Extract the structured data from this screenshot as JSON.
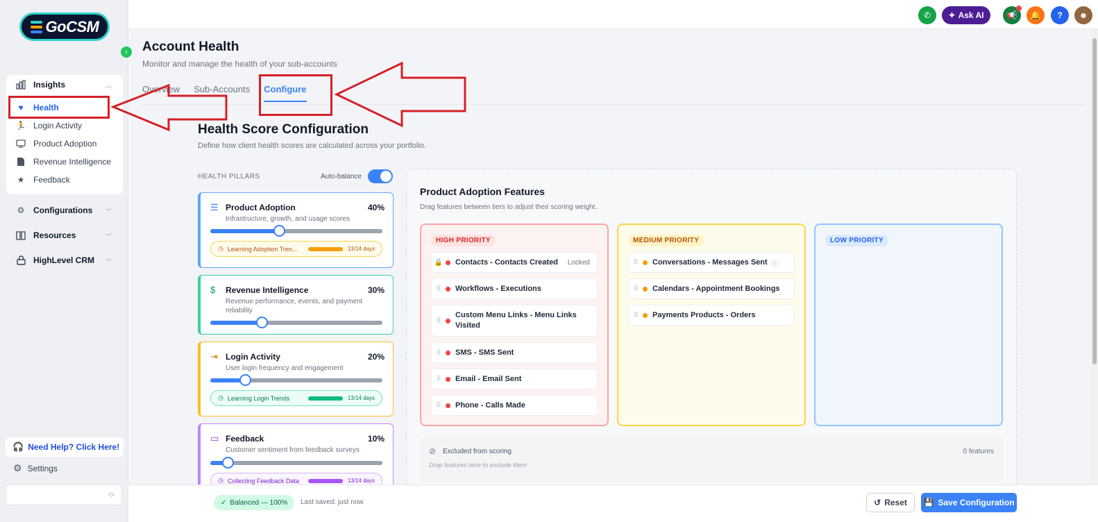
{
  "app": {
    "logo_text": "GoCSM"
  },
  "sidebar": {
    "insights": {
      "label": "Insights",
      "items": [
        {
          "label": "Health",
          "icon": "heart-pulse-icon",
          "active": true
        },
        {
          "label": "Login Activity",
          "icon": "running-icon"
        },
        {
          "label": "Product Adoption",
          "icon": "monitor-icon"
        },
        {
          "label": "Revenue Intelligence",
          "icon": "document-icon"
        },
        {
          "label": "Feedback",
          "icon": "star-icon"
        }
      ]
    },
    "groups": [
      {
        "label": "Configurations",
        "icon": "gear-icon"
      },
      {
        "label": "Resources",
        "icon": "book-icon"
      },
      {
        "label": "HighLevel CRM",
        "icon": "lock-icon"
      }
    ],
    "help_label": "Need Help? Click Here!",
    "settings_label": "Settings"
  },
  "topbar": {
    "ask_ai_label": "Ask AI"
  },
  "page": {
    "title": "Account Health",
    "subtitle": "Monitor and manage the health of your sub-accounts",
    "tabs": [
      "Overview",
      "Sub-Accounts",
      "Configure"
    ]
  },
  "config": {
    "title": "Health Score Configuration",
    "subtitle": "Define how client health scores are calculated across your portfolio.",
    "pillars_label": "HEALTH PILLARS",
    "auto_balance_label": "Auto-balance",
    "auto_balance_on": true,
    "pillars": [
      {
        "name": "Product Adoption",
        "pct": "40%",
        "value": 0.4,
        "desc": "Infrastructure, growth, and usage scores",
        "color": "#60a5fa",
        "trend": {
          "label": "Learning Adoption Tren...",
          "days": "13/14 days",
          "color": "#f59e0b"
        }
      },
      {
        "name": "Revenue Intelligence",
        "pct": "30%",
        "value": 0.3,
        "desc": "Revenue performance, events, and payment reliability",
        "color": "#34d399"
      },
      {
        "name": "Login Activity",
        "pct": "20%",
        "value": 0.2,
        "desc": "User login frequency and engagement",
        "color": "#fbbf24",
        "trend": {
          "label": "Learning Login Trends",
          "days": "13/14 days",
          "color": "#10b981"
        }
      },
      {
        "name": "Feedback",
        "pct": "10%",
        "value": 0.1,
        "desc": "Customer sentiment from feedback surveys",
        "color": "#c084fc",
        "trend": {
          "label": "Collecting Feedback Data",
          "days": "13/14 days",
          "color": "#a855f7"
        }
      }
    ]
  },
  "features": {
    "title": "Product Adoption Features",
    "subtitle": "Drag features between tiers to adjust their scoring weight.",
    "tiers": {
      "high": {
        "label": "HIGH PRIORITY",
        "items": [
          {
            "name": "Contacts - Contacts Created",
            "locked_label": "Locked"
          },
          {
            "name": "Workflows - Executions"
          },
          {
            "name": "Custom Menu Links - Menu Links Visited"
          },
          {
            "name": "SMS - SMS Sent"
          },
          {
            "name": "Email - Email Sent"
          },
          {
            "name": "Phone - Calls Made"
          }
        ]
      },
      "medium": {
        "label": "MEDIUM PRIORITY",
        "items": [
          {
            "name": "Conversations - Messages Sent"
          },
          {
            "name": "Calendars - Appointment Bookings"
          },
          {
            "name": "Payments Products - Orders"
          }
        ]
      },
      "low": {
        "label": "LOW PRIORITY",
        "items": []
      }
    },
    "excluded": {
      "label": "Excluded from scoring",
      "count": "0 features",
      "hint": "Drop features here to exclude them"
    }
  },
  "footer": {
    "balance_label": "Balanced — 100%",
    "saved_label": "Last saved: just now",
    "reset_label": "Reset",
    "save_label": "Save Configuration"
  },
  "colors": {
    "accent": "#3b82f6",
    "annotation": "#d42028"
  }
}
